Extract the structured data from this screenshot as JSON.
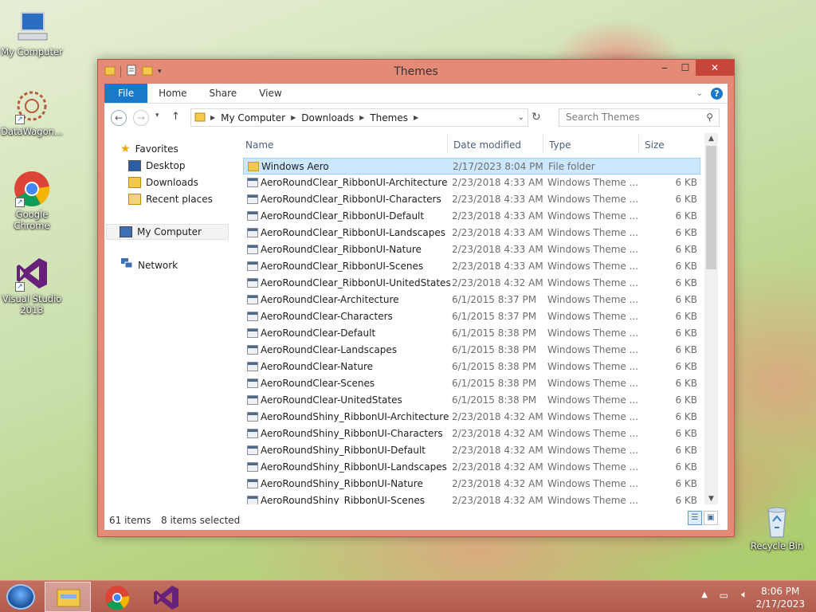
{
  "desktop": {
    "icons": [
      {
        "label": "My Computer"
      },
      {
        "label": "DataWagon..."
      },
      {
        "label": "Google Chrome"
      },
      {
        "label": "Visual Studio 2013"
      },
      {
        "label": "Recycle Bin"
      }
    ]
  },
  "window": {
    "title": "Themes",
    "ribbon_tabs": [
      "File",
      "Home",
      "Share",
      "View"
    ],
    "address": {
      "crumbs": [
        "My Computer",
        "Downloads",
        "Themes"
      ]
    },
    "search_placeholder": "Search Themes",
    "nav": {
      "favorites": "Favorites",
      "desktop": "Desktop",
      "downloads": "Downloads",
      "recent": "Recent places",
      "computer": "My Computer",
      "network": "Network"
    },
    "columns": {
      "name": "Name",
      "date": "Date modified",
      "type": "Type",
      "size": "Size"
    },
    "files": [
      {
        "name": "Windows Aero",
        "date": "2/17/2023 8:04 PM",
        "type": "File folder",
        "size": "",
        "kind": "folder",
        "selected": true
      },
      {
        "name": "AeroRoundClear_RibbonUI-Architecture",
        "date": "2/23/2018 4:33 AM",
        "type": "Windows Theme ...",
        "size": "6 KB",
        "kind": "theme"
      },
      {
        "name": "AeroRoundClear_RibbonUI-Characters",
        "date": "2/23/2018 4:33 AM",
        "type": "Windows Theme ...",
        "size": "6 KB",
        "kind": "theme"
      },
      {
        "name": "AeroRoundClear_RibbonUI-Default",
        "date": "2/23/2018 4:33 AM",
        "type": "Windows Theme ...",
        "size": "6 KB",
        "kind": "theme"
      },
      {
        "name": "AeroRoundClear_RibbonUI-Landscapes",
        "date": "2/23/2018 4:33 AM",
        "type": "Windows Theme ...",
        "size": "6 KB",
        "kind": "theme"
      },
      {
        "name": "AeroRoundClear_RibbonUI-Nature",
        "date": "2/23/2018 4:33 AM",
        "type": "Windows Theme ...",
        "size": "6 KB",
        "kind": "theme"
      },
      {
        "name": "AeroRoundClear_RibbonUI-Scenes",
        "date": "2/23/2018 4:33 AM",
        "type": "Windows Theme ...",
        "size": "6 KB",
        "kind": "theme"
      },
      {
        "name": "AeroRoundClear_RibbonUI-UnitedStates",
        "date": "2/23/2018 4:32 AM",
        "type": "Windows Theme ...",
        "size": "6 KB",
        "kind": "theme"
      },
      {
        "name": "AeroRoundClear-Architecture",
        "date": "6/1/2015 8:37 PM",
        "type": "Windows Theme ...",
        "size": "6 KB",
        "kind": "theme"
      },
      {
        "name": "AeroRoundClear-Characters",
        "date": "6/1/2015 8:37 PM",
        "type": "Windows Theme ...",
        "size": "6 KB",
        "kind": "theme"
      },
      {
        "name": "AeroRoundClear-Default",
        "date": "6/1/2015 8:38 PM",
        "type": "Windows Theme ...",
        "size": "6 KB",
        "kind": "theme"
      },
      {
        "name": "AeroRoundClear-Landscapes",
        "date": "6/1/2015 8:38 PM",
        "type": "Windows Theme ...",
        "size": "6 KB",
        "kind": "theme"
      },
      {
        "name": "AeroRoundClear-Nature",
        "date": "6/1/2015 8:38 PM",
        "type": "Windows Theme ...",
        "size": "6 KB",
        "kind": "theme"
      },
      {
        "name": "AeroRoundClear-Scenes",
        "date": "6/1/2015 8:38 PM",
        "type": "Windows Theme ...",
        "size": "6 KB",
        "kind": "theme"
      },
      {
        "name": "AeroRoundClear-UnitedStates",
        "date": "6/1/2015 8:38 PM",
        "type": "Windows Theme ...",
        "size": "6 KB",
        "kind": "theme"
      },
      {
        "name": "AeroRoundShiny_RibbonUI-Architecture",
        "date": "2/23/2018 4:32 AM",
        "type": "Windows Theme ...",
        "size": "6 KB",
        "kind": "theme"
      },
      {
        "name": "AeroRoundShiny_RibbonUI-Characters",
        "date": "2/23/2018 4:32 AM",
        "type": "Windows Theme ...",
        "size": "6 KB",
        "kind": "theme"
      },
      {
        "name": "AeroRoundShiny_RibbonUI-Default",
        "date": "2/23/2018 4:32 AM",
        "type": "Windows Theme ...",
        "size": "6 KB",
        "kind": "theme"
      },
      {
        "name": "AeroRoundShiny_RibbonUI-Landscapes",
        "date": "2/23/2018 4:32 AM",
        "type": "Windows Theme ...",
        "size": "6 KB",
        "kind": "theme"
      },
      {
        "name": "AeroRoundShiny_RibbonUI-Nature",
        "date": "2/23/2018 4:32 AM",
        "type": "Windows Theme ...",
        "size": "6 KB",
        "kind": "theme"
      },
      {
        "name": "AeroRoundShiny_RibbonUI-Scenes",
        "date": "2/23/2018 4:32 AM",
        "type": "Windows Theme ...",
        "size": "6 KB",
        "kind": "theme"
      }
    ],
    "status": {
      "items": "61 items",
      "selected": "8 items selected"
    }
  },
  "taskbar": {
    "time": "8:06 PM",
    "date": "2/17/2023"
  },
  "colors": {
    "accent": "#1979ca",
    "frame": "#e68a78",
    "selection": "#cce8ff",
    "close": "#c8453a"
  }
}
